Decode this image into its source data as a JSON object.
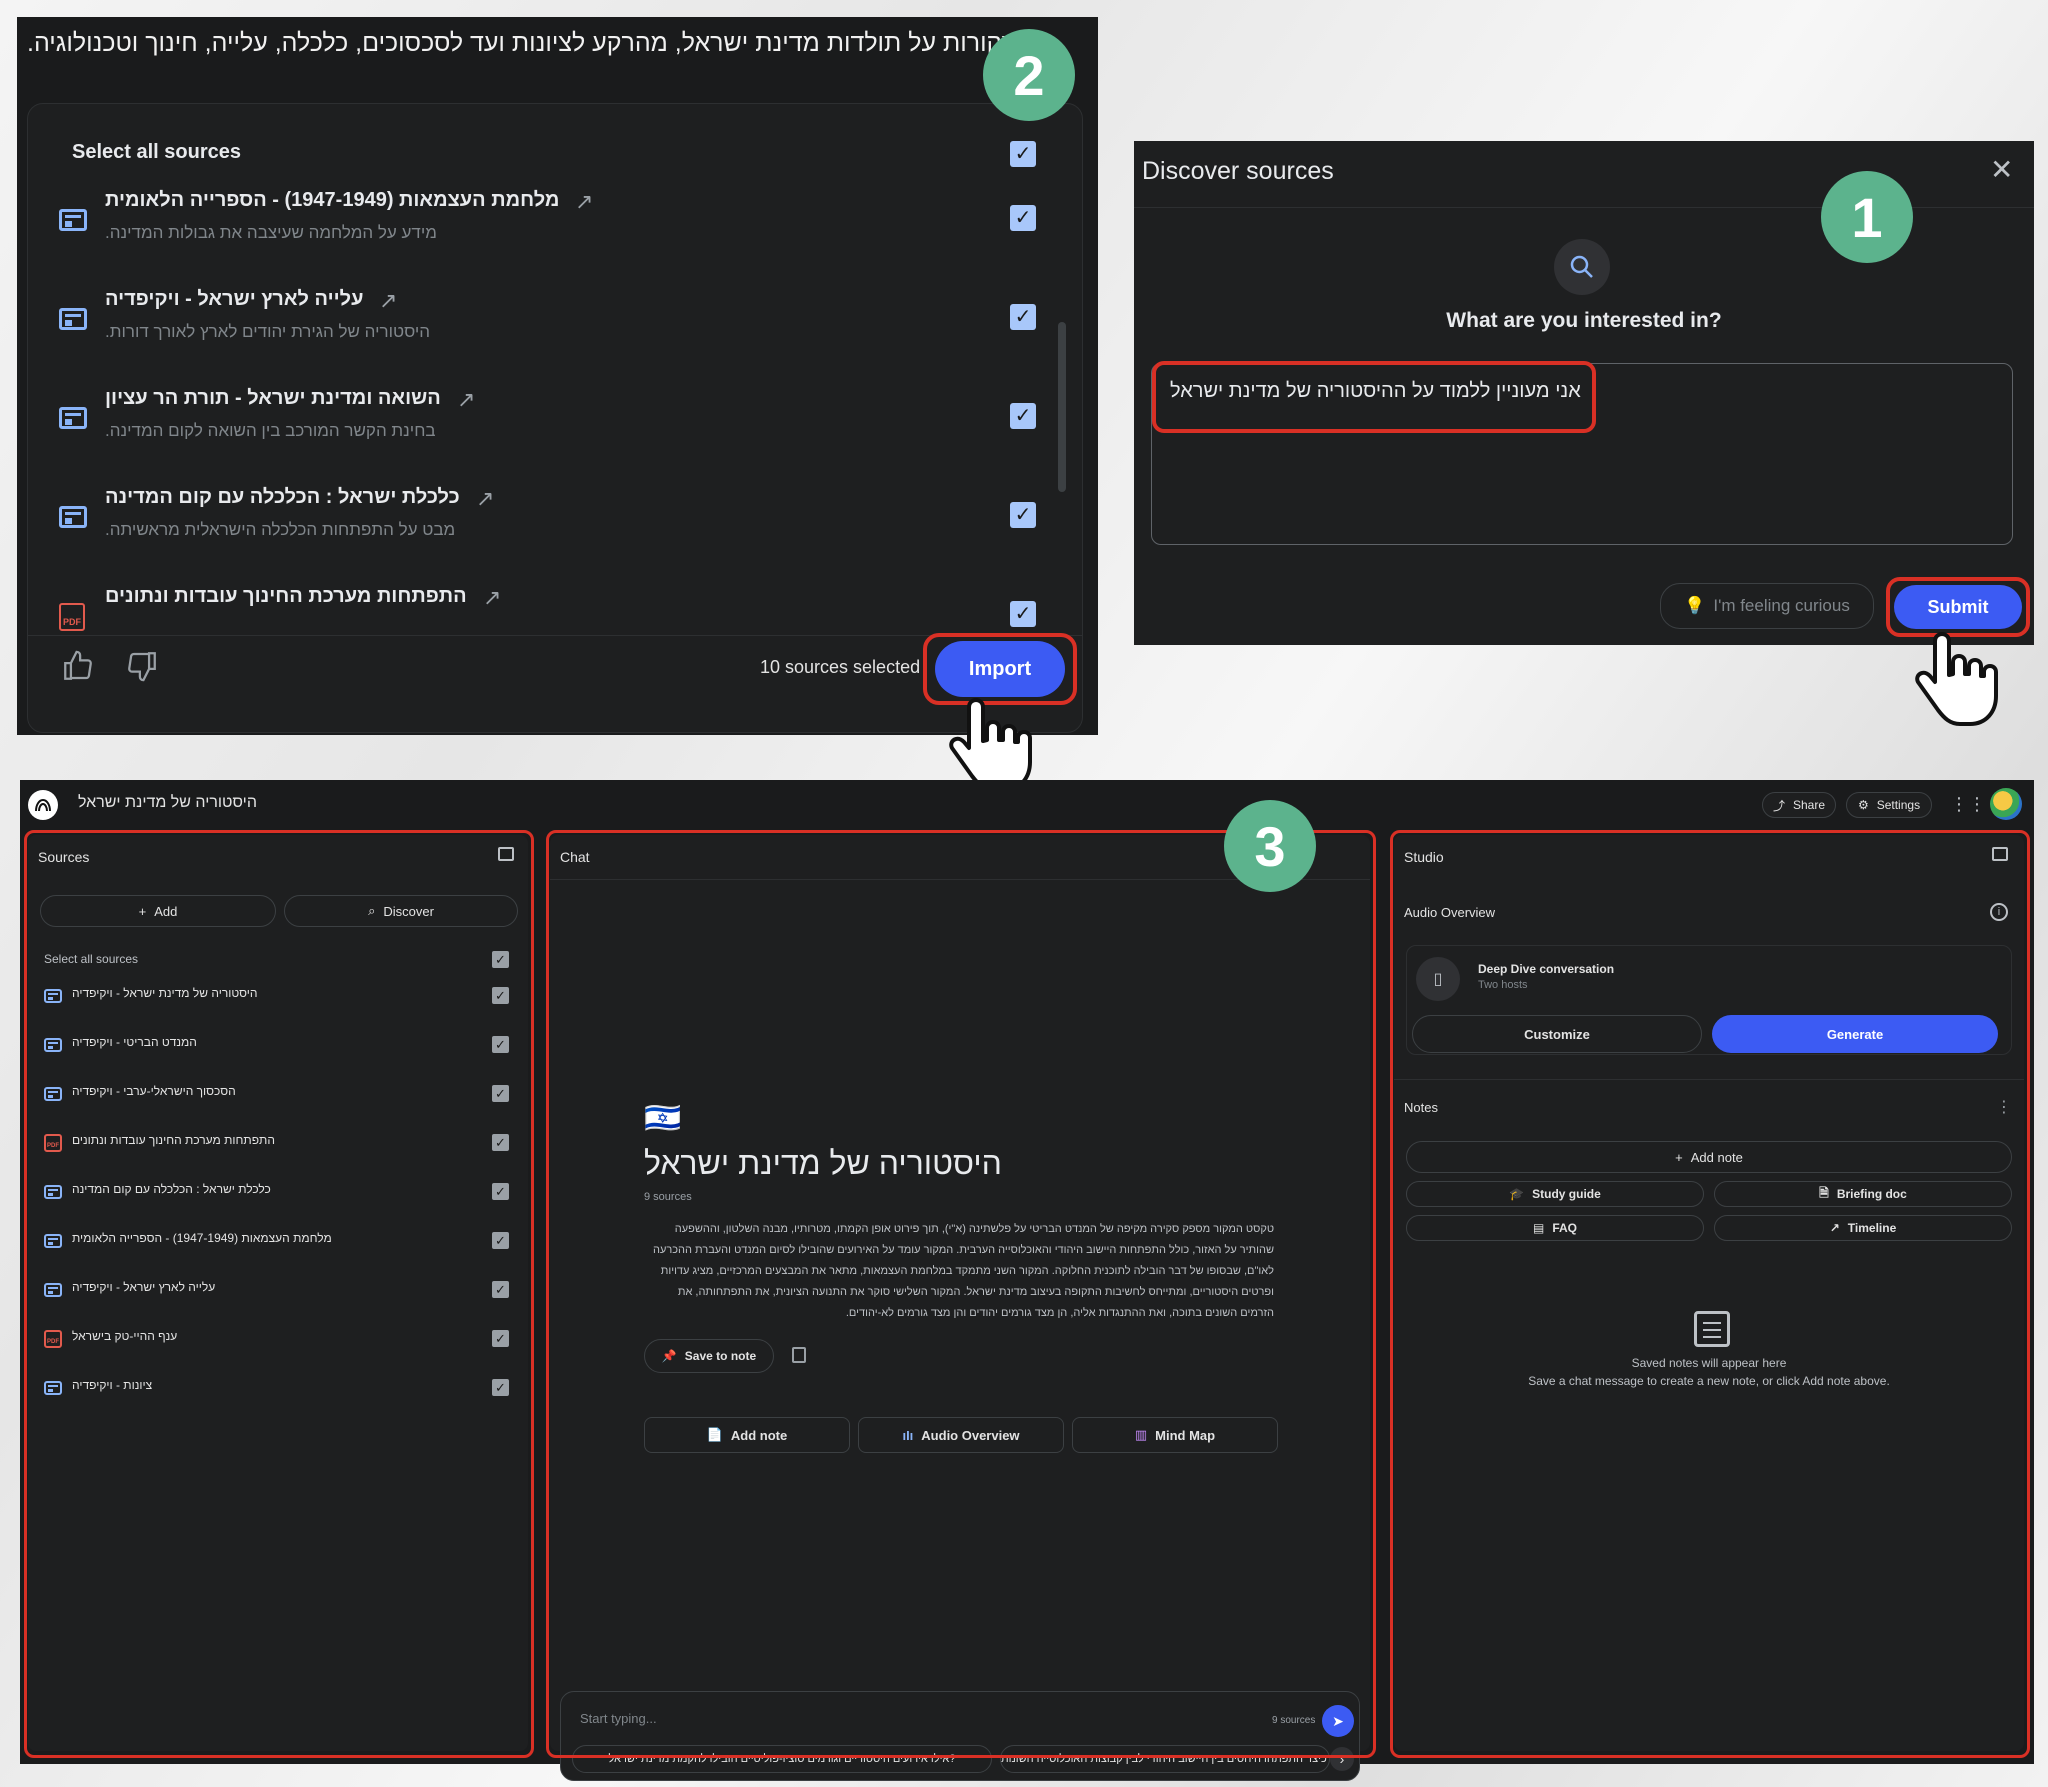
{
  "panel1": {
    "title": "Discover sources",
    "prompt": "What are you interested in?",
    "query": "אני מעוניין ללמוד על ההיסטוריה של מדינת ישראל",
    "feeling_curious": "I'm feeling curious",
    "submit": "Submit",
    "badge": "1"
  },
  "panel2": {
    "heading": "מקורות על תולדות מדינת ישראל, מהרקע לציונות ועד לסכסוכים, כלכלה, עלייה, חינוך וטכנולוגיה.",
    "select_all": "Select all sources",
    "badge": "2",
    "sources": [
      {
        "title": "מלחמת העצמאות (1947-1949) - הספרייה הלאומית",
        "desc": "מידע על המלחמה שעיצבה את גבולות המדינה.",
        "type": "web"
      },
      {
        "title": "עלייה לארץ ישראל - ויקיפדיה",
        "desc": "היסטוריה של הגירת יהודים לארץ לאורך דורות.",
        "type": "web"
      },
      {
        "title": "השואה ומדינת ישראל - תורת הר עציון",
        "desc": "בחינת הקשר המורכב בין השואה לקום המדינה.",
        "type": "web"
      },
      {
        "title": "כלכלת ישראל : הכלכלה עם קום המדינה",
        "desc": "מבט על התפתחות הכלכלה הישראלית מראשיתה.",
        "type": "web"
      },
      {
        "title": "התפתחות מערכת החינוך עובדות ונתונים",
        "desc": "",
        "type": "pdf"
      }
    ],
    "selected_count": "10 sources selected",
    "import": "Import"
  },
  "panel3": {
    "notebook_title": "היסטוריה של מדינת ישראל",
    "share": "Share",
    "settings": "Settings",
    "badge": "3",
    "sources": {
      "header": "Sources",
      "add": "Add",
      "discover": "Discover",
      "select_all": "Select all sources",
      "items": [
        {
          "label": "היסטוריה של מדינת ישראל - ויקיפדיה",
          "type": "web"
        },
        {
          "label": "המנדט הבריטי - ויקיפדיה",
          "type": "web"
        },
        {
          "label": "הסכסוך הישראלי-ערבי - ויקיפדיה",
          "type": "web"
        },
        {
          "label": "התפתחות מערכת החינוך עובדות ונתונים",
          "type": "pdf"
        },
        {
          "label": "כלכלת ישראל : הכלכלה עם קום המדינה",
          "type": "web"
        },
        {
          "label": "מלחמת העצמאות (1947-1949) - הספרייה הלאומית",
          "type": "web"
        },
        {
          "label": "עלייה לארץ ישראל - ויקיפדיה",
          "type": "web"
        },
        {
          "label": "ענף ההיי-טק בישראל",
          "type": "pdf"
        },
        {
          "label": "ציונות - ויקיפדיה",
          "type": "web"
        }
      ]
    },
    "chat": {
      "header": "Chat",
      "flag": "🇮🇱",
      "title": "היסטוריה של מדינת ישראל",
      "source_count": "9 sources",
      "summary": "טקסט המקור מספק סקירה מקיפה של המנדט הבריטי על פלשתינה (א\"י), תוך פירוט אופן הקמתו, מטרותיו, מבנה השלטון, וההשפעה שהותיר על האזור, כולל התפתחות היישוב היהודי והאוכלוסייה הערבית. המקור עומד על האירועים שהובילו לסיום המנדט והעברת ההכרעה לאו\"ם, שבסופו של דבר הובילה לתוכנית החלוקה. המקור השני מתמקד במלחמת העצמאות, מתאר את המבצעים המרכזיים, מציג עדויות ופרטים היסטוריים, ומתייחס לחשיבות התקופה בעיצוב מדינת ישראל. המקור השלישי סוקר את התנועה הציונית, את התפתחותה, את הזרמים השונים בתוכה, ואת ההתנגדות אליה, הן מצד גורמים יהודים והן מצד גורמים לא-יהודים.",
      "save_to_note": "Save to note",
      "add_note": "Add note",
      "audio_overview": "Audio Overview",
      "mind_map": "Mind Map",
      "input_placeholder": "Start typing...",
      "input_sources": "9 sources",
      "suggestion_1": "?אילו אירועים היסטוריים וגורמים סוציו-פוליטיים הובילו להקמת מדינת ישראל",
      "suggestion_2": "כיצד התפתחו היחסים בין היישוב היהודי לבין קבוצות האוכלוסייה השונות"
    },
    "studio": {
      "header": "Studio",
      "audio_overview": "Audio Overview",
      "deep_dive": "Deep Dive conversation",
      "two_hosts": "Two hosts",
      "customize": "Customize",
      "generate": "Generate",
      "notes": "Notes",
      "add_note": "Add note",
      "study_guide": "Study guide",
      "briefing_doc": "Briefing doc",
      "faq": "FAQ",
      "timeline": "Timeline",
      "empty_title": "Saved notes will appear here",
      "empty_desc": "Save a chat message to create a new note, or click Add note above."
    }
  },
  "colors": {
    "accent": "#3c5bf3",
    "badge": "#5cb38d",
    "highlight": "#d93025",
    "panel_bg": "#1e1f20"
  }
}
